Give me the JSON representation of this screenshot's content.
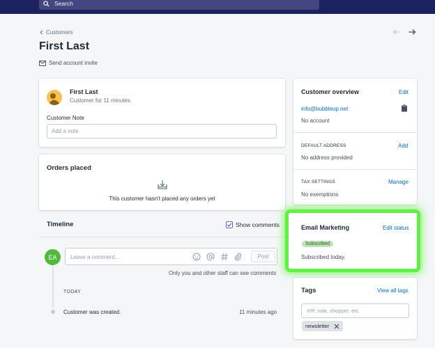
{
  "topbar": {
    "search_placeholder": "Search"
  },
  "breadcrumb": {
    "label": "Customers"
  },
  "page": {
    "title": "First Last",
    "invite_label": "Send account invite"
  },
  "customer_card": {
    "name": "First Last",
    "since": "Customer for 11 minutes",
    "note_label": "Customer Note",
    "note_placeholder": "Add a note"
  },
  "orders": {
    "title": "Orders placed",
    "empty_text": "This customer hasn't placed any orders yet"
  },
  "timeline": {
    "title": "Timeline",
    "show_comments_label": "Show comments",
    "show_comments_checked": true,
    "avatar_initials": "EA",
    "comment_placeholder": "Leave a comment...",
    "post_label": "Post",
    "staff_note": "Only you and other staff can see comments",
    "day_header": "TODAY",
    "events": [
      {
        "text": "Customer was created.",
        "time": "11 minutes ago"
      }
    ]
  },
  "overview": {
    "title": "Customer overview",
    "edit_label": "Edit",
    "email": "info@bubbleup.net",
    "account_status": "No account",
    "address_header": "DEFAULT ADDRESS",
    "address_add_label": "Add",
    "address_value": "No address provided",
    "tax_header": "TAX SETTINGS",
    "tax_manage_label": "Manage",
    "tax_value": "No exemptions"
  },
  "email_marketing": {
    "title": "Email Marketing",
    "edit_label": "Edit status",
    "badge": "Subscribed",
    "status_text": "Subscribed today."
  },
  "tags": {
    "title": "Tags",
    "view_all_label": "View all tags",
    "input_placeholder": "VIP, sale, shopper, etc.",
    "items": [
      "newsletter"
    ]
  },
  "colors": {
    "topbar": "#1c2260",
    "link": "#006fbb",
    "highlight": "#62f046",
    "badge": "#bbe5b3"
  }
}
